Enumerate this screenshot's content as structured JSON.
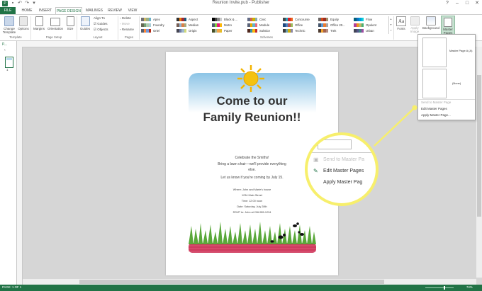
{
  "window": {
    "title": "Reunion Invite.pub - Publisher"
  },
  "tabs": [
    "FILE",
    "HOME",
    "INSERT",
    "PAGE DESIGN",
    "MAILINGS",
    "REVIEW",
    "VIEW"
  ],
  "ribbon": {
    "change_template": "Change Template",
    "options": "Options",
    "margins": "Margins",
    "orientation": "Orientation",
    "size": "Size",
    "guides": "Guides",
    "align_to": "Align To",
    "guides_chk": "Guides",
    "objects_chk": "Objects",
    "delete": "Delete",
    "move": "Move",
    "rename": "Rename",
    "fonts": "Fonts",
    "apply_image": "Apply Image",
    "background": "Background",
    "master_pages": "Master Pages",
    "groups": {
      "template": "Template",
      "page_setup": "Page Setup",
      "layout": "Layout",
      "pages": "Pages",
      "schemes": "Schemes"
    },
    "schemes": [
      {
        "name": "Apex",
        "colors": [
          "#6f6f74",
          "#ceb966",
          "#9cb084",
          "#6bb1c9"
        ]
      },
      {
        "name": "Foundry",
        "colors": [
          "#676a55",
          "#72a376",
          "#b0ccb0",
          "#a8cdd7"
        ]
      },
      {
        "name": "Oriel",
        "colors": [
          "#575f6d",
          "#fe8637",
          "#7598d9",
          "#b32c16"
        ]
      },
      {
        "name": "Aspect",
        "colors": [
          "#323232",
          "#f07f09",
          "#9f2936",
          "#1b587c"
        ]
      },
      {
        "name": "Median",
        "colors": [
          "#775f55",
          "#94b6d2",
          "#dd8047",
          "#a5ab81"
        ]
      },
      {
        "name": "Origin",
        "colors": [
          "#464653",
          "#727ca3",
          "#9fb8cd",
          "#d2da7a"
        ]
      },
      {
        "name": "Black & ...",
        "colors": [
          "#000000",
          "#444444",
          "#888888",
          "#cccccc"
        ]
      },
      {
        "name": "Metro",
        "colors": [
          "#4e5b6f",
          "#7fd13b",
          "#ea157a",
          "#feb80a"
        ]
      },
      {
        "name": "Paper",
        "colors": [
          "#444d26",
          "#a5b592",
          "#f3a447",
          "#e7bc29"
        ]
      },
      {
        "name": "Civic",
        "colors": [
          "#646b86",
          "#d16349",
          "#ccb400",
          "#8cadae"
        ]
      },
      {
        "name": "Module",
        "colors": [
          "#5a6378",
          "#f0ad00",
          "#60b5cc",
          "#e66c7d"
        ]
      },
      {
        "name": "Solstice",
        "colors": [
          "#4f271c",
          "#3891a7",
          "#feb80a",
          "#c32d2e"
        ]
      },
      {
        "name": "Concourse",
        "colors": [
          "#464646",
          "#2da2bf",
          "#da1f28",
          "#eb641b"
        ]
      },
      {
        "name": "Office",
        "colors": [
          "#1f497d",
          "#4f81bd",
          "#c0504d",
          "#9bbb59"
        ]
      },
      {
        "name": "Technic",
        "colors": [
          "#3b3b3b",
          "#6ea0b0",
          "#ccaf0a",
          "#8d89a4"
        ]
      },
      {
        "name": "Equity",
        "colors": [
          "#696464",
          "#d34817",
          "#9b2d1f",
          "#a28e6a"
        ]
      },
      {
        "name": "Office 20...",
        "colors": [
          "#44546a",
          "#5b9bd5",
          "#ed7d31",
          "#a5a5a5"
        ]
      },
      {
        "name": "Trek",
        "colors": [
          "#4e3b30",
          "#f0a22e",
          "#a5644e",
          "#b58b80"
        ]
      },
      {
        "name": "Flow",
        "colors": [
          "#04617b",
          "#0f6fc6",
          "#009dd9",
          "#0bd0d9"
        ]
      },
      {
        "name": "Opulent",
        "colors": [
          "#b13f9a",
          "#f09415",
          "#c1b56b",
          "#4baf73"
        ]
      },
      {
        "name": "Urban",
        "colors": [
          "#424456",
          "#53548a",
          "#438086",
          "#a04da3"
        ]
      }
    ]
  },
  "page_nav": {
    "label": "P...",
    "page_number": "1"
  },
  "document": {
    "heading_line1": "Come to our",
    "heading_line2": "Family Reunion!!",
    "body_line1": "Celebrate the Smiths!",
    "body_line2": "Bring a lawn chair—we'll provide everything",
    "body_line3": "else.",
    "body_line4": "Let us know if you're coming by July 15.",
    "detail_line1": "Where: John and Marie's house",
    "detail_line2": "1234 Main Street",
    "detail_line3": "Time: 12:00 noon",
    "detail_line4": "Date: Saturday, July 28th",
    "detail_line5": "RSVP to: John at 206-555-1234"
  },
  "dropdown": {
    "master_a_label": "Master Page A (A)",
    "none_label": "(None)",
    "send_to_master": "Send to Master Page",
    "edit_master": "Edit Master Pages",
    "apply_master": "Apply Master Page..."
  },
  "magnifier": {
    "send_to_master": "Send to Master Pa",
    "edit_master": "Edit Master Pages",
    "apply_master": "Apply Master Pag"
  },
  "status": {
    "page": "PAGE: 1 OF 1",
    "zoom": "74%"
  },
  "colors": {
    "accent": "#217346",
    "callout": "#f7ef6c",
    "sky_top": "#8cc4e6",
    "ground": "#cf3b5e"
  }
}
